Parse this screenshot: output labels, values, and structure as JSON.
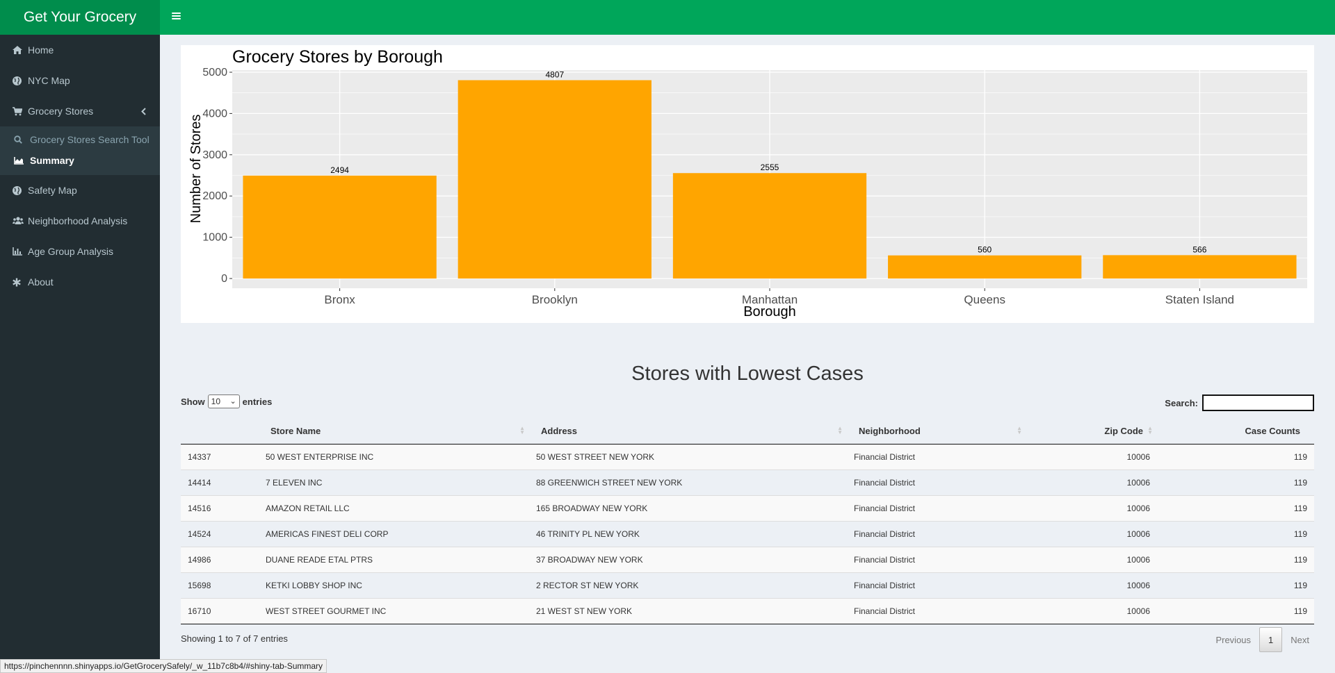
{
  "header": {
    "app_title": "Get Your Grocery",
    "toggle_icon": "hamburger-icon"
  },
  "sidebar": {
    "items": [
      {
        "label": "Home",
        "icon": "home-icon"
      },
      {
        "label": "NYC Map",
        "icon": "globe-icon"
      },
      {
        "label": "Grocery Stores",
        "icon": "shopping-cart-icon"
      },
      {
        "label": "Safety Map",
        "icon": "globe-icon"
      },
      {
        "label": "Neighborhood Analysis",
        "icon": "users-icon"
      },
      {
        "label": "Age Group Analysis",
        "icon": "bar-chart-icon"
      },
      {
        "label": "About",
        "icon": "asterisk-icon"
      }
    ],
    "submenu": [
      {
        "label": "Grocery Stores Search Tool",
        "icon": "search-icon"
      },
      {
        "label": "Summary",
        "icon": "area-chart-icon",
        "active": true
      }
    ]
  },
  "chart_data": {
    "type": "bar",
    "title": "Grocery Stores by Borough",
    "xlabel": "Borough",
    "ylabel": "Number of Stores",
    "categories": [
      "Bronx",
      "Brooklyn",
      "Manhattan",
      "Queens",
      "Staten Island"
    ],
    "values": [
      2494,
      4807,
      2555,
      560,
      566
    ],
    "data_labels": [
      "2494",
      "4807",
      "2555",
      "560",
      "566"
    ],
    "yticks": [
      0,
      1000,
      2000,
      3000,
      4000,
      5000
    ],
    "ytick_labels": [
      "0",
      "1000",
      "2000",
      "3000",
      "4000",
      "5000"
    ],
    "ylim": [
      0,
      5000
    ],
    "bar_color": "#FFA500",
    "panel_color": "#EBEBEB",
    "grid": true
  },
  "table": {
    "title": "Stores with Lowest Cases",
    "show_label": "Show",
    "entries_label": "entries",
    "page_length": "10",
    "search_label": "Search:",
    "columns": [
      "",
      "Store Name",
      "Address",
      "Neighborhood",
      "Zip Code",
      "Case Counts"
    ],
    "rows": [
      [
        "14337",
        "50 WEST ENTERPRISE INC",
        "50 WEST STREET NEW YORK",
        "Financial District",
        "10006",
        "119"
      ],
      [
        "14414",
        "7 ELEVEN INC",
        "88 GREENWICH STREET NEW YORK",
        "Financial District",
        "10006",
        "119"
      ],
      [
        "14516",
        "AMAZON RETAIL LLC",
        "165 BROADWAY NEW YORK",
        "Financial District",
        "10006",
        "119"
      ],
      [
        "14524",
        "AMERICAS FINEST DELI CORP",
        "46 TRINITY PL NEW YORK",
        "Financial District",
        "10006",
        "119"
      ],
      [
        "14986",
        "DUANE READE ETAL PTRS",
        "37 BROADWAY NEW YORK",
        "Financial District",
        "10006",
        "119"
      ],
      [
        "15698",
        "KETKI LOBBY SHOP INC",
        "2 RECTOR ST NEW YORK",
        "Financial District",
        "10006",
        "119"
      ],
      [
        "16710",
        "WEST STREET GOURMET INC",
        "21 WEST ST NEW YORK",
        "Financial District",
        "10006",
        "119"
      ]
    ],
    "info": "Showing 1 to 7 of 7 entries",
    "pagination": {
      "previous": "Previous",
      "current": "1",
      "next": "Next"
    }
  },
  "status_url": "https://pinchennnn.shinyapps.io/GetGrocerySafely/_w_11b7c8b4/#shiny-tab-Summary"
}
